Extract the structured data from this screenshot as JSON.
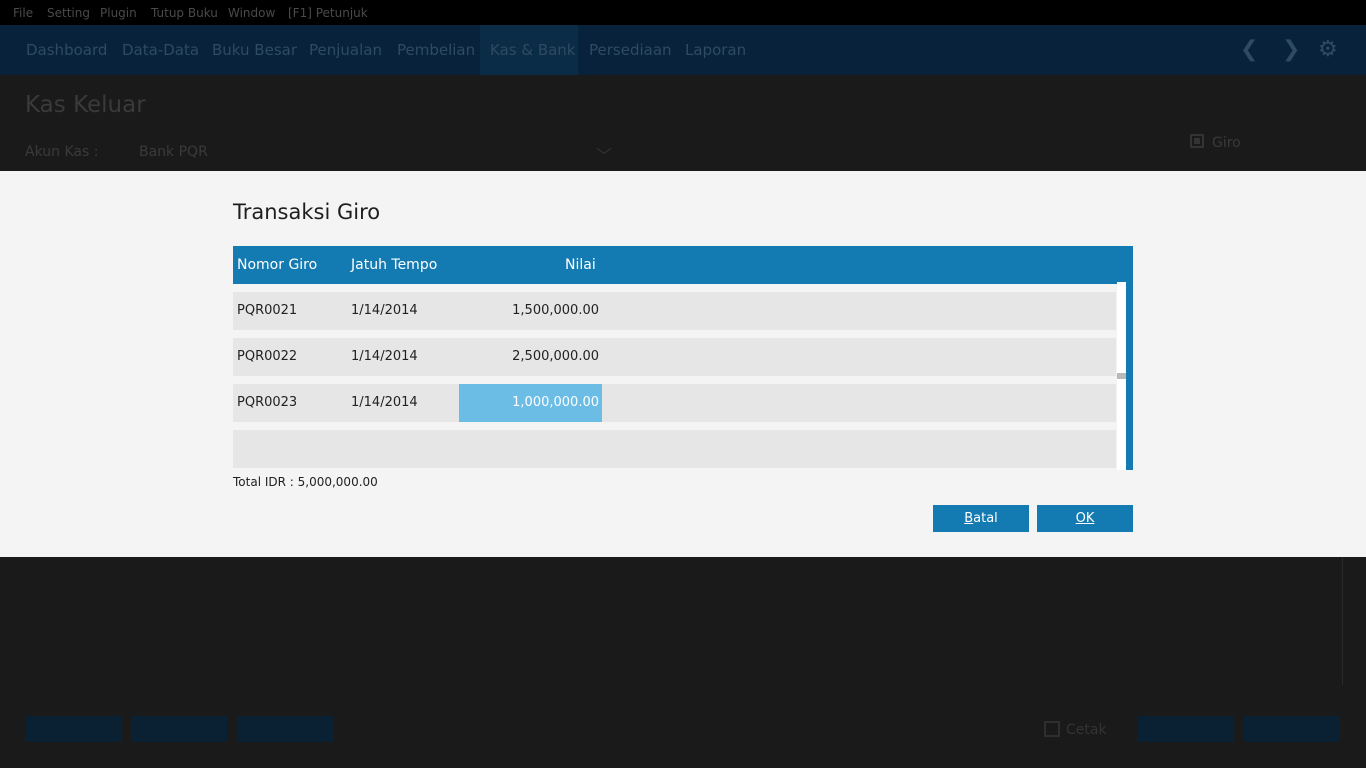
{
  "menu": [
    "File",
    "Setting",
    "Plugin",
    "Tutup Buku",
    "Window",
    "[F1] Petunjuk"
  ],
  "nav": {
    "items": [
      "Dashboard",
      "Data-Data",
      "Buku Besar",
      "Penjualan",
      "Pembelian",
      "Kas & Bank",
      "Persediaan",
      "Laporan"
    ],
    "back_icon": "chevron-left-icon",
    "forward_icon": "chevron-right-icon",
    "settings_icon": "gear-icon"
  },
  "page": {
    "title": "Kas Keluar",
    "akun_kas_label": "Akun Kas :",
    "akun_kas_value": "Bank PQR",
    "giro_label": "Giro",
    "giro_checked": true,
    "cetak_label": "Cetak",
    "cetak_checked": false
  },
  "dialog": {
    "title": "Transaksi Giro",
    "columns": [
      "Nomor Giro",
      "Jatuh Tempo",
      "Nilai"
    ],
    "rows": [
      {
        "nomor": "PQR0021",
        "jatuh_tempo": "1/14/2014",
        "nilai": "1,500,000.00"
      },
      {
        "nomor": "PQR0022",
        "jatuh_tempo": "1/14/2014",
        "nilai": "2,500,000.00"
      },
      {
        "nomor": "PQR0023",
        "jatuh_tempo": "1/14/2014",
        "nilai": "1,000,000.00"
      }
    ],
    "selected_row": 2,
    "total": "Total IDR : 5,000,000.00",
    "cancel_label_mnemonic": "B",
    "cancel_label_rest": "atal",
    "ok_label_mnemonic": "O",
    "ok_label_rest": "K"
  },
  "colors": {
    "header_blue": "#147bb2",
    "selected_cell": "#6bbde6",
    "row_bg": "#e6e6e6",
    "dialog_bg": "#f4f4f4"
  }
}
